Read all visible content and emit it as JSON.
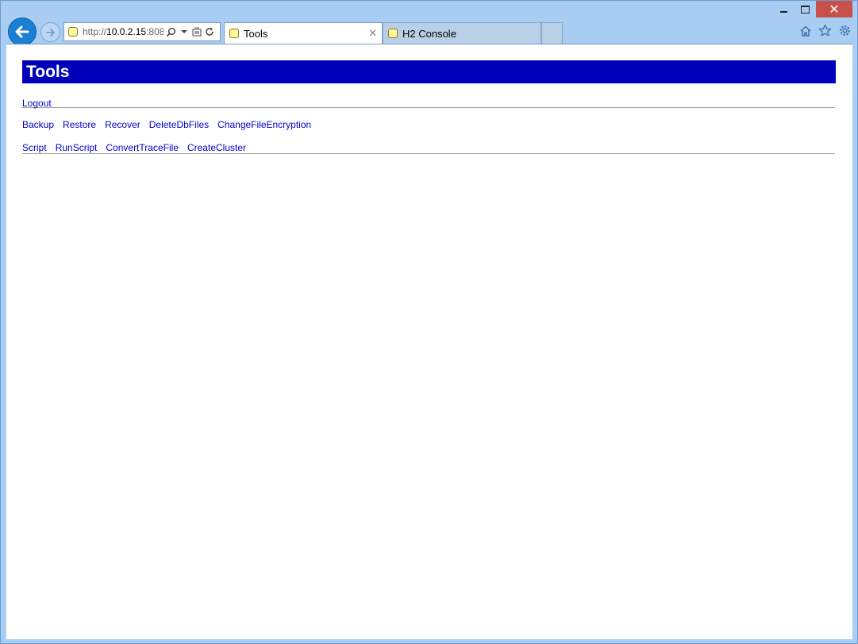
{
  "browser": {
    "address": {
      "protocol": "http://",
      "host": "10.0.2.15",
      "rest": ":808"
    },
    "tabs": [
      {
        "label": "Tools",
        "active": true
      },
      {
        "label": "H2 Console",
        "active": false
      }
    ],
    "close_tab_glyph": "✕"
  },
  "page": {
    "title": "Tools",
    "logout_label": "Logout",
    "tool_rows": [
      [
        "Backup",
        "Restore",
        "Recover",
        "DeleteDbFiles",
        "ChangeFileEncryption"
      ],
      [
        "Script",
        "RunScript",
        "ConvertTraceFile",
        "CreateCluster"
      ]
    ]
  },
  "colors": {
    "header_bg": "#0000bb",
    "link": "#0000cc",
    "frame": "#a9cdf2",
    "close_button": "#c7504b"
  }
}
